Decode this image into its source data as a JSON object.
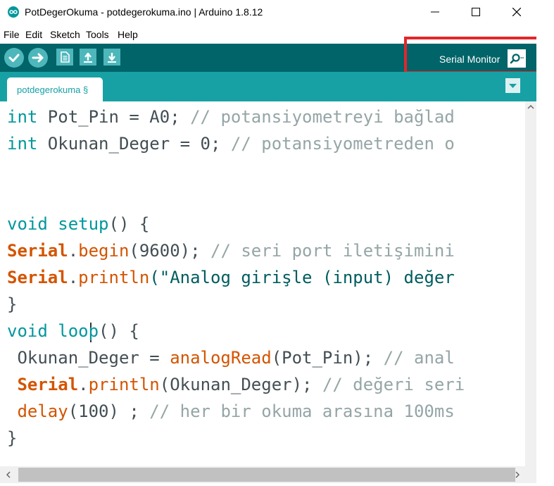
{
  "window": {
    "title": "PotDegerOkuma - potdegerokuma.ino | Arduino 1.8.12"
  },
  "menu": {
    "items": [
      "File",
      "Edit",
      "Sketch",
      "Tools",
      "Help"
    ]
  },
  "toolbar": {
    "serial_monitor_label": "Serial Monitor"
  },
  "tabs": [
    {
      "label": "potdegerokuma §"
    }
  ],
  "code": [
    [
      {
        "t": "int",
        "c": "kw"
      },
      {
        "t": " Pot_Pin = A0; "
      },
      {
        "t": "// potansiyometreyi bağlad",
        "c": "cm"
      }
    ],
    [
      {
        "t": "int",
        "c": "kw"
      },
      {
        "t": " Okunan_Deger = 0; "
      },
      {
        "t": "// potansiyometreden o",
        "c": "cm"
      }
    ],
    [],
    [
      {
        "t": "void",
        "c": "kw"
      },
      {
        "t": " "
      },
      {
        "t": "setup",
        "c": "kw"
      },
      {
        "t": "() {"
      }
    ],
    [
      {
        "t": "Serial",
        "c": "obj"
      },
      {
        "t": "."
      },
      {
        "t": "begin",
        "c": "fn"
      },
      {
        "t": "(9600); "
      },
      {
        "t": "// seri port iletişimini",
        "c": "cm"
      }
    ],
    [
      {
        "t": "Serial",
        "c": "obj"
      },
      {
        "t": "."
      },
      {
        "t": "println",
        "c": "fn"
      },
      {
        "t": "(\"Analog girişle (input) değer",
        "c": "str"
      }
    ],
    [
      {
        "t": "}"
      }
    ],
    [
      {
        "t": "void",
        "c": "kw"
      },
      {
        "t": " "
      },
      {
        "t": "loop",
        "c": "kw"
      },
      {
        "t": "() {"
      }
    ],
    [
      {
        "t": " Okunan_Deger = "
      },
      {
        "t": "analogRead",
        "c": "fn"
      },
      {
        "t": "(Pot_Pin); "
      },
      {
        "t": "// anal",
        "c": "cm"
      }
    ],
    [
      {
        "t": " "
      },
      {
        "t": "Serial",
        "c": "obj"
      },
      {
        "t": "."
      },
      {
        "t": "println",
        "c": "fn"
      },
      {
        "t": "(Okunan_Deger); "
      },
      {
        "t": "// değeri seri",
        "c": "cm"
      }
    ],
    [
      {
        "t": " "
      },
      {
        "t": "delay",
        "c": "fn"
      },
      {
        "t": "(100) ; "
      },
      {
        "t": "// her bir okuma arasına 100ms",
        "c": "cm"
      }
    ],
    [
      {
        "t": "}"
      }
    ]
  ],
  "colors": {
    "toolbar_bg": "#006468",
    "tabbar_bg": "#17a1a5",
    "button_bg": "#4db7bb",
    "keyword": "#00979c",
    "function": "#d35400",
    "comment": "#95a5a6",
    "highlight_box": "#e3262a"
  }
}
